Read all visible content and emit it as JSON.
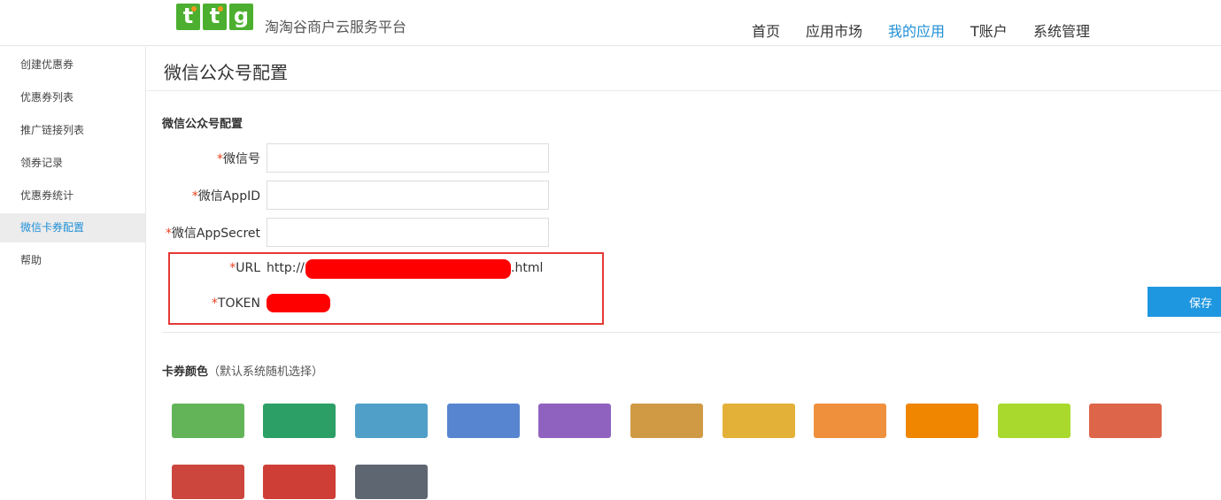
{
  "header": {
    "logo_letters": [
      "t",
      "t",
      "g"
    ],
    "brand": "淘淘谷商户云服务平台",
    "nav": [
      {
        "label": "首页",
        "active": false
      },
      {
        "label": "应用市场",
        "active": false
      },
      {
        "label": "我的应用",
        "active": true
      },
      {
        "label": "T账户",
        "active": false
      },
      {
        "label": "系统管理",
        "active": false
      }
    ]
  },
  "sidebar": {
    "items": [
      {
        "label": "创建优惠券",
        "active": false
      },
      {
        "label": "优惠券列表",
        "active": false
      },
      {
        "label": "推广链接列表",
        "active": false
      },
      {
        "label": "领券记录",
        "active": false
      },
      {
        "label": "优惠券统计",
        "active": false
      },
      {
        "label": "微信卡券配置",
        "active": true
      },
      {
        "label": "帮助",
        "active": false
      }
    ]
  },
  "main": {
    "page_title": "微信公众号配置",
    "section_title": "微信公众号配置",
    "required_mark": "*",
    "fields": {
      "wechat_id": {
        "label": "微信号",
        "value": ""
      },
      "app_id": {
        "label": "微信AppID",
        "value": ""
      },
      "app_secret": {
        "label": "微信AppSecret",
        "value": ""
      },
      "url": {
        "label": "URL",
        "prefix": "http://",
        "suffix": ".html"
      },
      "token": {
        "label": "TOKEN"
      }
    },
    "save_label": "保存",
    "card_color": {
      "title": "卡券颜色",
      "hint": "（默认系统随机选择）",
      "colors": [
        "#63b359",
        "#2c9f67",
        "#509fc9",
        "#5885cf",
        "#9062c0",
        "#d09a45",
        "#e4b138",
        "#ee903c",
        "#f08500",
        "#a9d92d",
        "#dd6549",
        "#cc463d",
        "#cf3e36",
        "#5e6671"
      ]
    }
  },
  "accent_color": "#1f8fd6",
  "required_color": "#e8421d"
}
